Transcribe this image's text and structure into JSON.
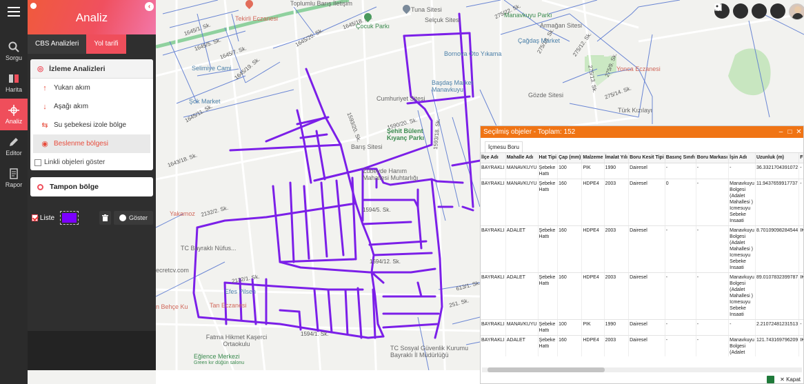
{
  "sidebar": {
    "items": [
      {
        "label": "Sorgu",
        "icon": "search-icon"
      },
      {
        "label": "Harita",
        "icon": "book-icon"
      },
      {
        "label": "Analiz",
        "icon": "analysis-icon"
      },
      {
        "label": "Editor",
        "icon": "pencil-icon"
      },
      {
        "label": "Rapor",
        "icon": "report-icon"
      }
    ]
  },
  "panel": {
    "title": "Analiz",
    "tabs": [
      "CBS Analizleri",
      "Yol tarifi"
    ],
    "izleme": {
      "title": "İzleme Analizleri",
      "options": [
        "Yukarı akım",
        "Aşağı akım",
        "Su şebekesi izole bölge",
        "Beslenme bölgesi"
      ],
      "linkli": "Linkli objeleri göster"
    },
    "tampon": "Tampon bölge",
    "liste_label": "Liste",
    "goster_label": "Göster",
    "swatch_color": "#7b00ff"
  },
  "map": {
    "street_labels": [
      "1645/18. Sk.",
      "1645/1. Sk.",
      "1645/5. Sk.",
      "1645/7. Sk.",
      "1645/19. Sk.",
      "1645/20. Sk.",
      "1643/18. Sk.",
      "1645/11. Sk.",
      "1590/20. Sk.",
      "1593/20. Sk.",
      "1593/18. Sk.",
      "2132/2. Sk.",
      "1594/12. Sk.",
      "1594/5. Sk.",
      "275/22. Sk.",
      "275/12. Sk.",
      "275/9. Sk.",
      "275/18. Sk.",
      "275/13. Sk.",
      "275/14. Sk.",
      "613/1. Sk.",
      "251. Sk.",
      "2132/1. Sk.",
      "1594/1. Sk."
    ],
    "pois": [
      {
        "name": "Tekirli Eczanesi",
        "color": "red"
      },
      {
        "name": "Tuna Sitesi",
        "color": "gray"
      },
      {
        "name": "Selçuk Sitesi",
        "color": "gray"
      },
      {
        "name": "Çocuk Parkı",
        "color": "green"
      },
      {
        "name": "Manavkuyu Parkı",
        "color": "green"
      },
      {
        "name": "Armağan Sitesi",
        "color": "gray"
      },
      {
        "name": "Çağdaş Market",
        "color": "blue"
      },
      {
        "name": "Bornova Oto Yıkama",
        "color": "blue"
      },
      {
        "name": "Selimiye Cami",
        "color": "blue"
      },
      {
        "name": "Şok Market",
        "color": "blue"
      },
      {
        "name": "Cumhuriyet Sitesi",
        "color": "gray"
      },
      {
        "name": "Başdaş Market Manavkuyu",
        "color": "blue"
      },
      {
        "name": "Gözde Sitesi",
        "color": "gray"
      },
      {
        "name": "Yonca Eczanesi",
        "color": "red"
      },
      {
        "name": "Türk Kızılayı",
        "color": "gray"
      },
      {
        "name": "Şehit Bülent Kıyanç Parkı",
        "color": "green"
      },
      {
        "name": "Barış Sitesi",
        "color": "gray"
      },
      {
        "name": "Zübeyde Hanım Mahallesi Muhtarlığı",
        "color": "gray"
      },
      {
        "name": "Yakamoz",
        "color": "red"
      },
      {
        "name": "TC Bayraklı Nüfus...",
        "color": "gray"
      },
      {
        "name": "ecretcv.com",
        "color": "gray"
      },
      {
        "name": "Efes Pilsen",
        "color": "blue"
      },
      {
        "name": "Tan Eczanesi",
        "color": "red"
      },
      {
        "name": "n Behçe Ku",
        "color": "red"
      },
      {
        "name": "Fatma Hikmet Kaşerci Ortaokulu",
        "color": "gray"
      },
      {
        "name": "Eğlence Merkezi",
        "color": "green"
      },
      {
        "name": "Green kır düğün salonu",
        "color": "green"
      },
      {
        "name": "TC Sosyal Güvenlik Kurumu Bayraklı İl Müdürlüğü",
        "color": "gray"
      },
      {
        "name": "Toplumlu Barış İletişim",
        "color": "gray"
      }
    ],
    "controls": [
      "search-icon",
      "layers-icon",
      "microphone-icon",
      "globe-icon"
    ]
  },
  "selection": {
    "title": "Seçilmiş objeler - Toplam: 152",
    "tab": "İçmesu Boru",
    "columns": [
      "İlçe Adı",
      "Mahalle Adı",
      "Hat Tipi",
      "Çap (mm)",
      "Malzeme",
      "İmalat Yılı",
      "Boru Kesit Tipi",
      "Basınç Sınıfı",
      "Boru Markası",
      "İşin Adı",
      "Uzunluk (m)",
      "Firma"
    ],
    "rows": [
      [
        "BAYRAKLI",
        "MANAVKUYU",
        "Şebeke Hattı",
        "100",
        "PIK",
        "1990",
        "Dairesel",
        "-",
        "-",
        "-",
        "36.3321704391072",
        "-"
      ],
      [
        "BAYRAKLI",
        "MANAVKUYU",
        "Şebeke Hattı",
        "160",
        "HDPE4",
        "2003",
        "Dairesel",
        "0",
        "-",
        "Manavkuyu Bolgesi (Adalet Mahallesi ) Icmesuyu Sebeke Insaati",
        "11.9437659917737",
        "-"
      ],
      [
        "BAYRAKLI",
        "ADALET",
        "Şebeke Hattı",
        "160",
        "HDPE4",
        "2003",
        "Dairesel",
        "-",
        "-",
        "Manavkuyu Bolgesi (Adalet Mahallesi ) Icmesuyu Sebeke Insaati",
        "8.70109098284544",
        "IKRA"
      ],
      [
        "BAYRAKLI",
        "ADALET",
        "Şebeke Hattı",
        "160",
        "HDPE4",
        "2003",
        "Dairesel",
        "-",
        "-",
        "Manavkuyu Bolgesi (Adalet Mahallesi ) Icmesuyu Sebeke Insaati",
        "89.0107832399787",
        "IKRA"
      ],
      [
        "BAYRAKLI",
        "MANAVKUYU",
        "Şebeke Hattı",
        "100",
        "PIK",
        "1990",
        "Dairesel",
        "-",
        "-",
        "-",
        "2.21072481231513",
        "-"
      ],
      [
        "BAYRAKLI",
        "ADALET",
        "Şebeke Hattı",
        "160",
        "HDPE4",
        "2003",
        "Dairesel",
        "-",
        "-",
        "Manavkuyu Bolgesi (Adalet Mahallesi",
        "121.743169796209",
        "IKRA"
      ]
    ],
    "close_label": "Kapat"
  }
}
